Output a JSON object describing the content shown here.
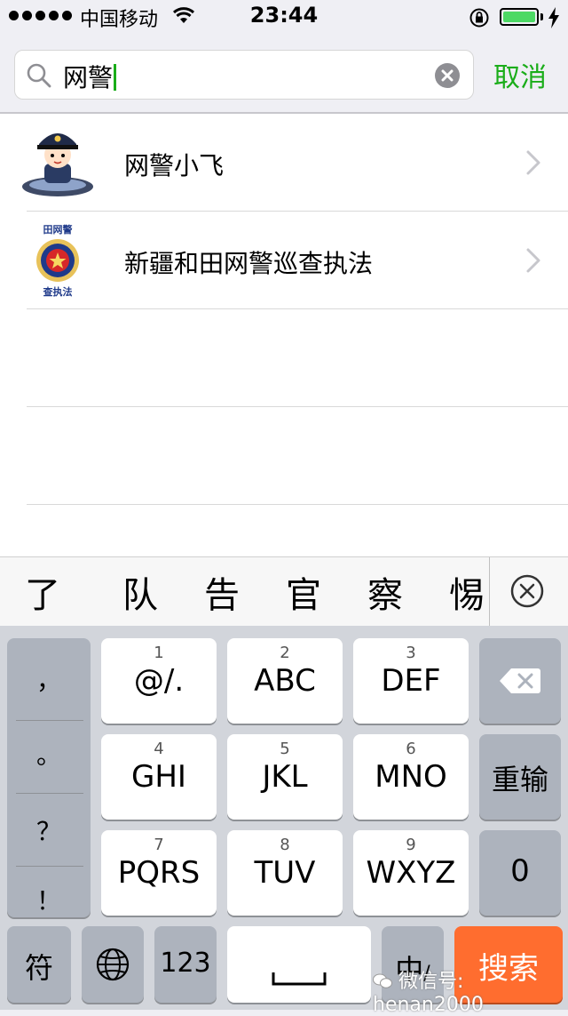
{
  "status": {
    "carrier": "中国移动",
    "time": "23:44"
  },
  "search": {
    "query": "网警",
    "cancel": "取消"
  },
  "results": [
    {
      "title": "网警小飞",
      "avatar": "cartoon-police-avatar"
    },
    {
      "title": "新疆和田网警巡查执法",
      "avatar": "police-badge-avatar",
      "badge_top": "田网警",
      "badge_bottom": "查执法"
    }
  ],
  "candidates": [
    "了",
    "队",
    "告",
    "官",
    "察",
    "惕"
  ],
  "keyboard": {
    "punct": [
      "，",
      "。",
      "？",
      "！"
    ],
    "keys": [
      {
        "num": "1",
        "label": "@/."
      },
      {
        "num": "2",
        "label": "ABC"
      },
      {
        "num": "3",
        "label": "DEF"
      },
      {
        "num": "4",
        "label": "GHI"
      },
      {
        "num": "5",
        "label": "JKL"
      },
      {
        "num": "6",
        "label": "MNO"
      },
      {
        "num": "7",
        "label": "PQRS"
      },
      {
        "num": "8",
        "label": "TUV"
      },
      {
        "num": "9",
        "label": "WXYZ"
      }
    ],
    "retype": "重输",
    "zero": "0",
    "symbol": "符",
    "num_mode": "123",
    "chinese_mode": "中",
    "chinese_mode_suffix": "/",
    "search": "搜索"
  },
  "watermark": "微信号: henan2000",
  "colors": {
    "accent": "#1aad19",
    "search_key": "#ff6d2f",
    "battery": "#4cd964"
  }
}
